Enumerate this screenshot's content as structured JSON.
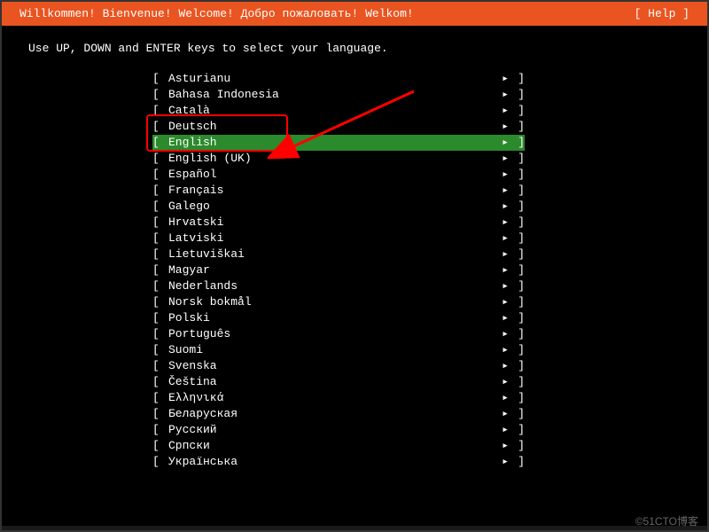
{
  "header": {
    "title": "Willkommen! Bienvenue! Welcome! Добро пожаловать! Welkom!",
    "help_label": "[ Help ]"
  },
  "instruction": "Use UP, DOWN and ENTER keys to select your language.",
  "languages": [
    "Asturianu",
    "Bahasa Indonesia",
    "Català",
    "Deutsch",
    "English",
    "English (UK)",
    "Español",
    "Français",
    "Galego",
    "Hrvatski",
    "Latviski",
    "Lietuviškai",
    "Magyar",
    "Nederlands",
    "Norsk bokmål",
    "Polski",
    "Português",
    "Suomi",
    "Svenska",
    "Čeština",
    "Ελληνικά",
    "Беларуская",
    "Русский",
    "Српски",
    "Українська"
  ],
  "selected_index": 4,
  "glyphs": {
    "bracket_open": "[",
    "bracket_close": "]",
    "arrow": "▸"
  },
  "annotation": {
    "red_box_around": "English",
    "arrow_points_to": "English"
  },
  "watermark": "©51CTO博客"
}
